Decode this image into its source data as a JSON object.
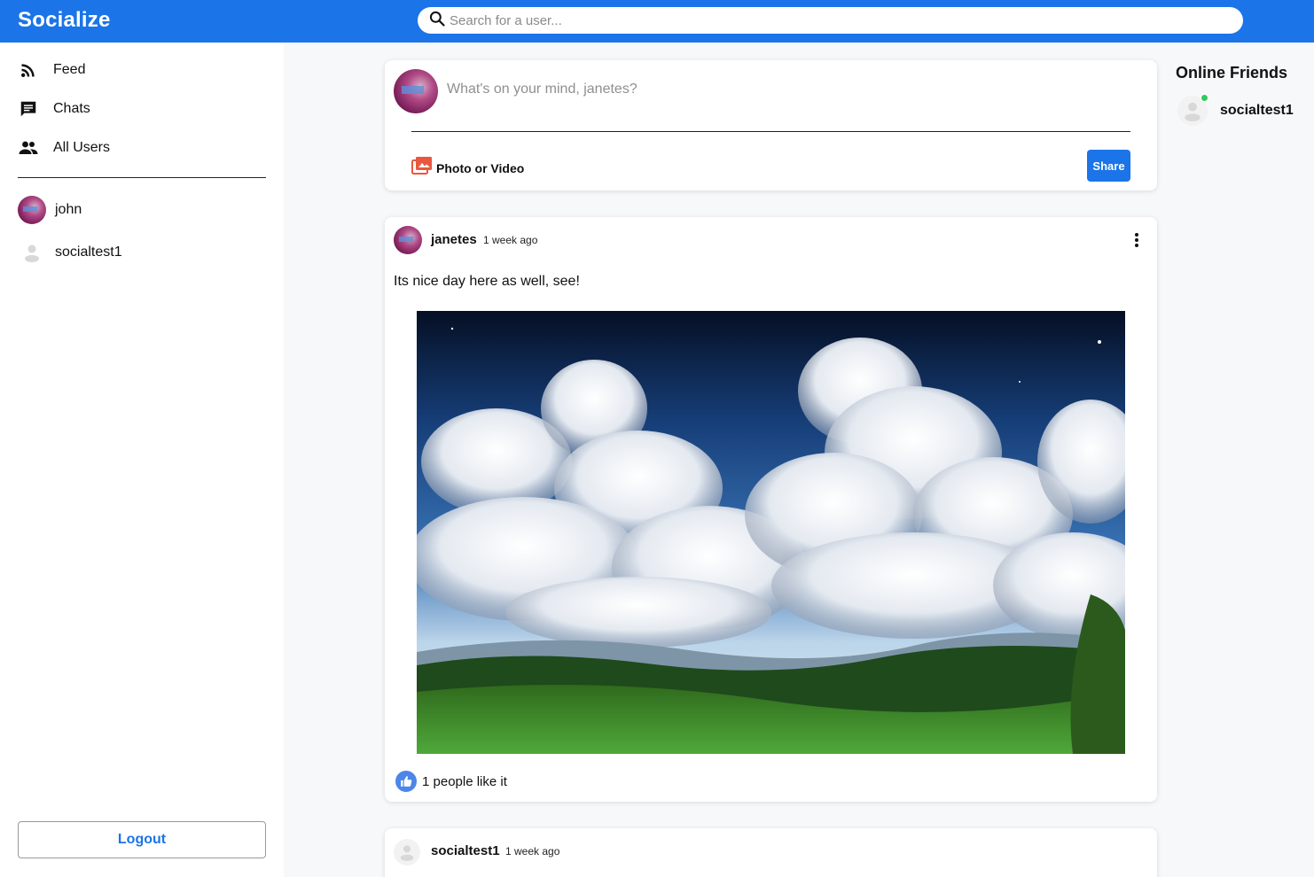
{
  "app": {
    "title": "Socialize"
  },
  "search": {
    "placeholder": "Search for a user..."
  },
  "sidebar": {
    "nav": [
      {
        "label": "Feed",
        "icon": "rss-feed-icon"
      },
      {
        "label": "Chats",
        "icon": "chat-icon"
      },
      {
        "label": "All Users",
        "icon": "people-icon"
      }
    ],
    "users": [
      {
        "name": "john",
        "avatar": "photo"
      },
      {
        "name": "socialtest1",
        "avatar": "default"
      }
    ],
    "logout_label": "Logout"
  },
  "composer": {
    "placeholder": "What's on your mind, janetes?",
    "photo_label": "Photo or Video",
    "share_label": "Share"
  },
  "posts": [
    {
      "author": "janetes",
      "time": "1 week ago",
      "text": "Its nice day here as well, see!",
      "image": "landscape with clouds, hills and green meadow",
      "likes_text": "1 people like it"
    },
    {
      "author": "socialtest1",
      "time": "1 week ago"
    }
  ],
  "rightbar": {
    "title": "Online Friends",
    "friends": [
      {
        "name": "socialtest1",
        "status": "online"
      }
    ]
  },
  "colors": {
    "brand": "#1b74e8",
    "online": "#2ecc5b",
    "photo_icon": "#e9573f"
  }
}
